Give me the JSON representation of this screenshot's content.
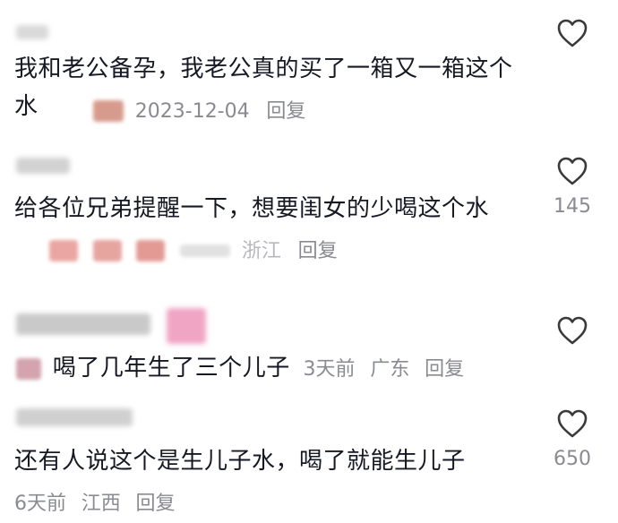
{
  "comments": [
    {
      "text": "我和老公备孕，我老公真的买了一箱又一箱这个水",
      "date": "2023-12-04",
      "location": "",
      "reply_label": "回复",
      "like_count": ""
    },
    {
      "text": "给各位兄弟提醒一下，想要闺女的少喝这个水",
      "date": "",
      "location": "浙江",
      "reply_label": "回复",
      "like_count": "145"
    },
    {
      "text": "喝了几年生了三个儿子",
      "date": "3天前",
      "location": "广东",
      "reply_label": "回复",
      "like_count": ""
    },
    {
      "text": "还有人说这个是生儿子水，喝了就能生儿子",
      "date": "6天前",
      "location": "江西",
      "reply_label": "回复",
      "like_count": "650"
    }
  ],
  "icons": {
    "like": "heart-outline-icon"
  },
  "colors": {
    "text": "#161823",
    "meta": "#8a8b91",
    "icon": "#3a3a3a"
  }
}
